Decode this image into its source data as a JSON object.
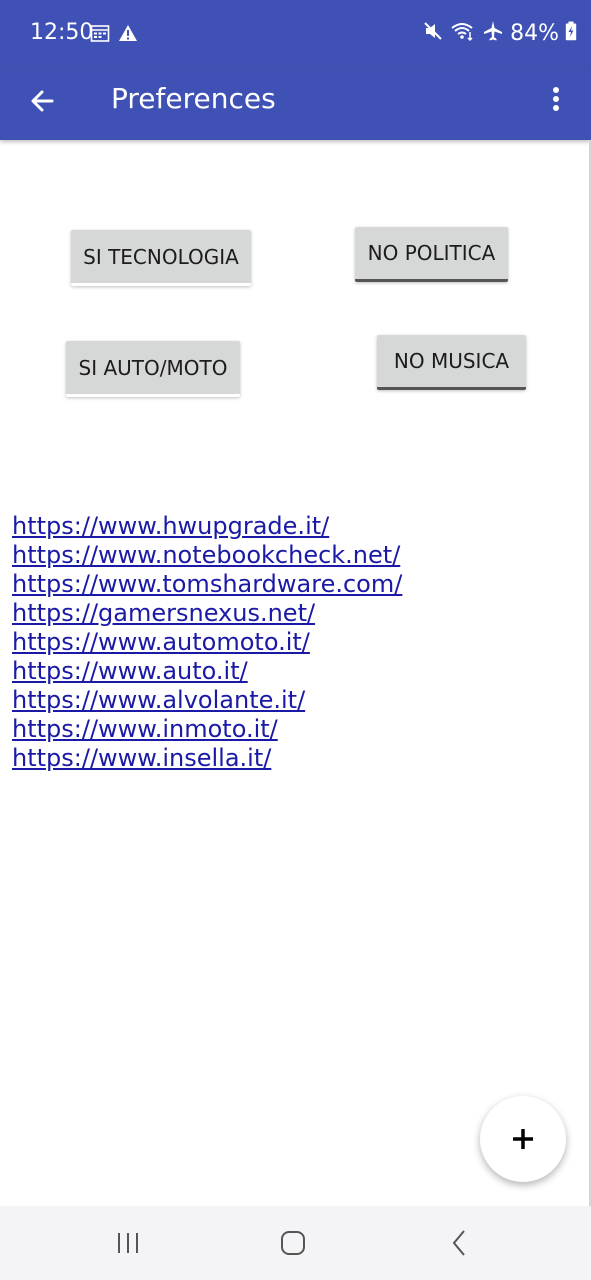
{
  "status_bar": {
    "time": "12:50",
    "battery": "84%",
    "icons_left": [
      "calendar-icon",
      "warning-icon"
    ],
    "icons_right": [
      "mute-icon",
      "wifi-icon",
      "airplane-icon",
      "battery-charging-icon"
    ]
  },
  "app_bar": {
    "title": "Preferences",
    "back_icon": "arrow-left-icon",
    "menu_icon": "more-vert-icon",
    "color": "#3f51b5"
  },
  "buttons": {
    "si_tecnologia": "SI TECNOLOGIA",
    "no_politica": "NO POLITICA",
    "si_auto_moto": "SI AUTO/MOTO",
    "no_musica": "NO MUSICA"
  },
  "links": [
    "https://www.hwupgrade.it/",
    "https://www.notebookcheck.net/",
    "https://www.tomshardware.com/",
    "https://gamersnexus.net/",
    "https://www.automoto.it/",
    "https://www.auto.it/",
    "https://www.alvolante.it/",
    "https://www.inmoto.it/",
    "https://www.insella.it/"
  ],
  "fab": {
    "icon": "plus-icon"
  },
  "nav_bar": {
    "icons": [
      "recents-icon",
      "home-icon",
      "back-icon"
    ]
  }
}
